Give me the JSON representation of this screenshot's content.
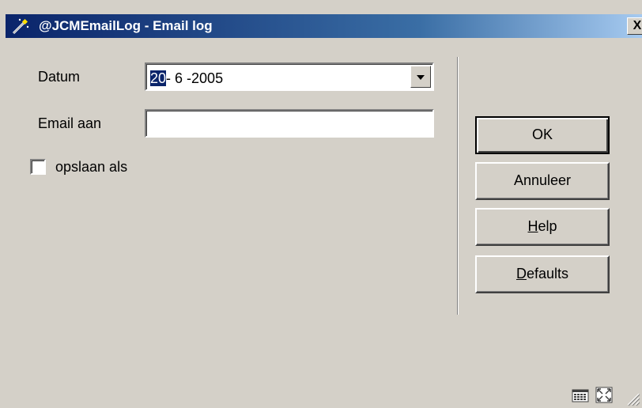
{
  "window": {
    "title": "@JCMEmailLog - Email log",
    "close_symbol": "X"
  },
  "form": {
    "datum_label": "Datum",
    "datum_value_selected": "20",
    "datum_value_rest": "- 6 -2005",
    "email_label": "Email aan",
    "email_value": "",
    "opslaan_label": "opslaan als",
    "opslaan_checked": false
  },
  "buttons": {
    "ok": "OK",
    "annuleer": "Annuleer",
    "help_mnemonic": "H",
    "help_rest": "elp",
    "defaults_mnemonic": "D",
    "defaults_rest": "efaults"
  },
  "icons": {
    "title": "magic-wand-icon",
    "calendar": "calendar-grid-icon",
    "maximize": "maximize-arrows-icon",
    "dropdown": "chevron-down-icon",
    "grip": "resize-grip-icon"
  },
  "colors": {
    "title_gradient_start": "#0a246a",
    "title_gradient_end": "#a6caf0",
    "face": "#d4d0c8",
    "selection": "#0a246a"
  }
}
